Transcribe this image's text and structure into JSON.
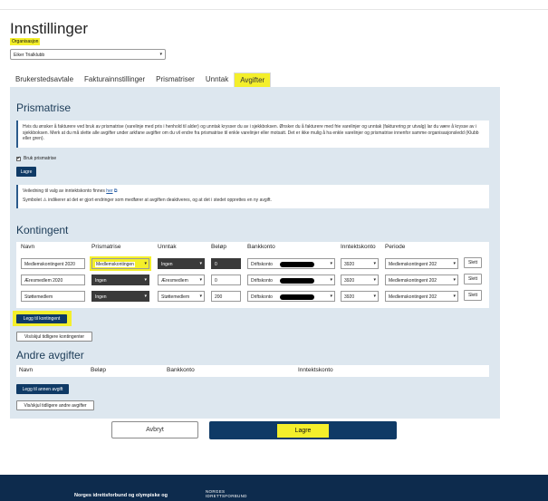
{
  "page": {
    "title": "Innstillinger",
    "org_label": "Organisasjon",
    "org_value": "Eiker Trialklubb"
  },
  "tabs": [
    {
      "label": "Brukerstedsavtale"
    },
    {
      "label": "Fakturainnstillinger"
    },
    {
      "label": "Prismatriser"
    },
    {
      "label": "Unntak"
    },
    {
      "label": "Avgifter",
      "active": true
    }
  ],
  "prismatrise": {
    "heading": "Prismatrise",
    "info_text": "Hvis du ønsker å fakturere ved bruk av prismatrise (varelinje med pris i henhold til alder) og unntak krysser du av i sjekkboksen. Ønsker du å fakturere med frie varelinjer og unntak (fakturering pr utvalg) lar du være å krysse av i sjekkboksen. Merk at du må slette alle avgifter under arkfane avgifter om du vil endre fra prismatrise til enkle varelinjer eller motsatt. Det er ikke mulig å ha enkle varelinjer og prismatrise innenfor samme organisasjonsledd (Klubb eller gren).",
    "checkbox_label": "Bruk prismatrise",
    "checkbox_checked": true,
    "save_label": "Lagre",
    "guide_text": "Veiledning til valg av inntektskonto finnes",
    "guide_link": "her",
    "symbol_text_pre": "Symbolet",
    "symbol_text_post": "indikerer at det er gjort endringer som medfører at avgiften deaktiveres, og at det i stedet opprettes en ny avgift."
  },
  "kontingent": {
    "heading": "Kontingent",
    "columns": [
      "Navn",
      "Prismatrise",
      "Unntak",
      "Beløp",
      "Bankkonto",
      "Inntektskonto",
      "Periode"
    ],
    "rows": [
      {
        "navn": "Medlemskontingent 2020",
        "prismatrise": "Medlemskontingen",
        "unntak": "Ingen",
        "belop": "0",
        "bankkonto": "Driftskonto",
        "inntektskonto": "3920",
        "periode": "Medlemskontingent 202",
        "slett": "Slett"
      },
      {
        "navn": "Æresmedlem 2020",
        "prismatrise": "Ingen",
        "unntak": "Æresmedlem",
        "belop": "0",
        "bankkonto": "Driftskonto",
        "inntektskonto": "3920",
        "periode": "Medlemskontingent 202",
        "slett": "Slett"
      },
      {
        "navn": "Støttemedlem",
        "prismatrise": "Ingen",
        "unntak": "Støttemedlem",
        "belop": "200",
        "bankkonto": "Driftskonto",
        "inntektskonto": "3920",
        "periode": "Medlemskontingent 202",
        "slett": "Slett"
      }
    ],
    "add_label": "Legg til kontingent",
    "toggle_label": "Vis/skjul tidligere kontingenter"
  },
  "andre": {
    "heading": "Andre avgifter",
    "columns": [
      "Navn",
      "Beløp",
      "Bankkonto",
      "Inntektskonto"
    ],
    "add_label": "Legg til annen avgift",
    "toggle_label": "Vis/skjul tidligere andre avgifter"
  },
  "actions": {
    "cancel_label": "Avbryt",
    "save_label": "Lagre"
  },
  "footer": {
    "org_text": "Norges idrettsforbund og olympiske og",
    "logo_line1": "NORGES",
    "logo_line2": "IDRETTSFORBUND"
  },
  "colors": {
    "highlight": "#f4ef2b",
    "primary": "#0f3a66",
    "panel_bg": "#dde7ef",
    "footer_bg": "#0d2b4d"
  }
}
